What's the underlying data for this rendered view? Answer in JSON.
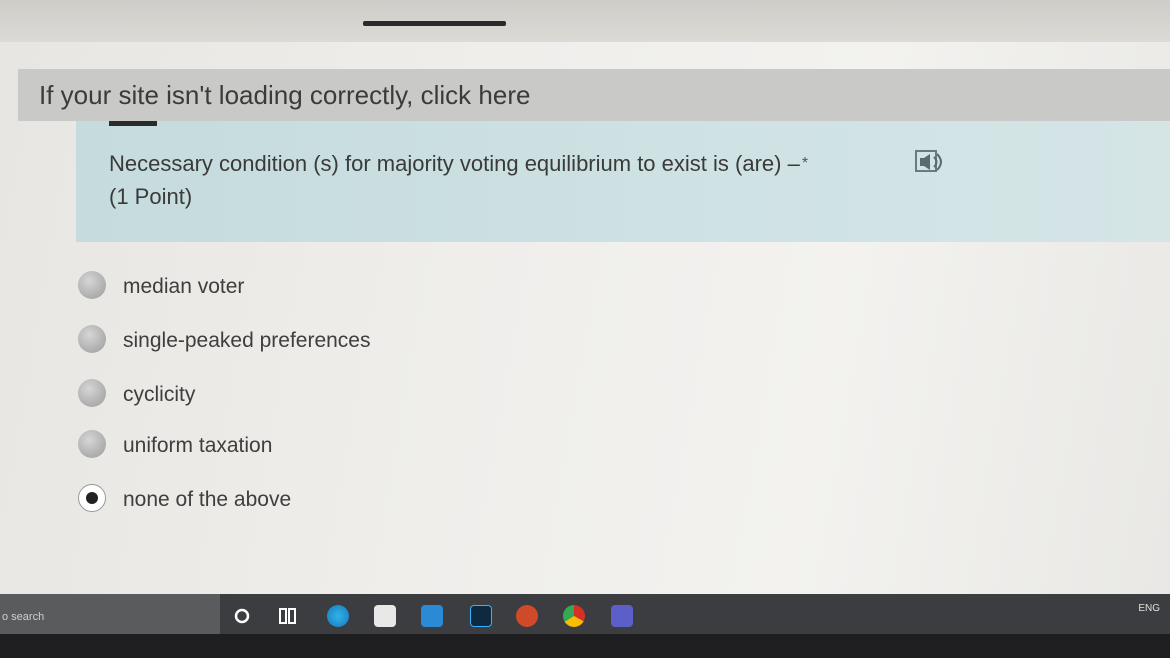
{
  "banner": {
    "link_text": "If your site isn't loading correctly, click here"
  },
  "question": {
    "text": "Necessary condition (s) for majority voting equilibrium to exist is (are) –",
    "required_marker": "*",
    "points": "(1 Point)"
  },
  "options": [
    {
      "label": "median voter",
      "selected": false
    },
    {
      "label": "single-peaked preferences",
      "selected": false
    },
    {
      "label": "cyclicity",
      "selected": false
    },
    {
      "label": "uniform taxation",
      "selected": false
    },
    {
      "label": "none of the above",
      "selected": true
    }
  ],
  "taskbar": {
    "search_text": "o search",
    "tray_text": "ENG",
    "icons": [
      "cortana-icon",
      "task-view-icon",
      "edge-icon",
      "store-icon",
      "mail-icon",
      "photoshop-icon",
      "powerpoint-icon",
      "chrome-icon",
      "teams-icon"
    ]
  },
  "colors": {
    "question_bg": "#cfe2e4",
    "banner_bg": "#c9c9c7",
    "taskbar_bg": "#3b3d40"
  }
}
